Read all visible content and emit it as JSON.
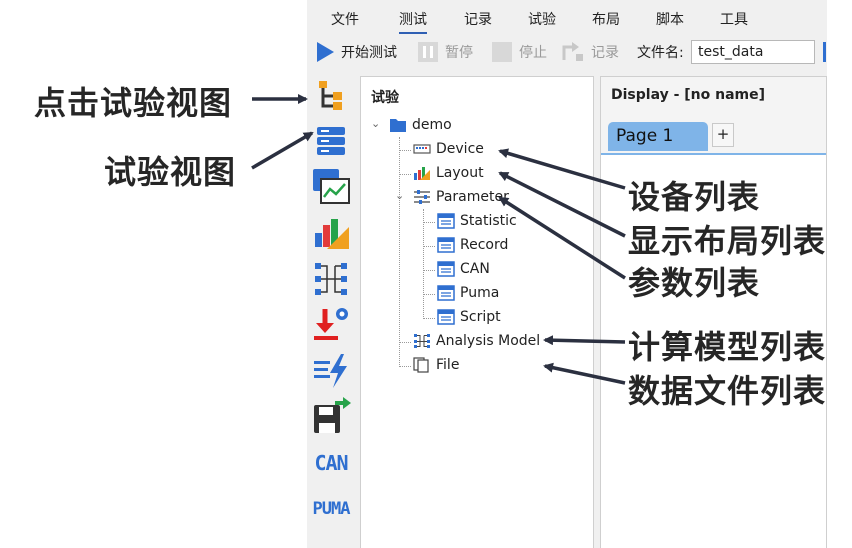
{
  "menu": {
    "items": [
      {
        "label": "文件"
      },
      {
        "label": "测试"
      },
      {
        "label": "记录"
      },
      {
        "label": "试验"
      },
      {
        "label": "布局"
      },
      {
        "label": "脚本"
      },
      {
        "label": "工具"
      }
    ],
    "active": "测试"
  },
  "toolbar": {
    "start_label": "开始测试",
    "pause_label": "暂停",
    "stop_label": "停止",
    "record_label": "记录",
    "filename_label": "文件名:",
    "filename_value": "test_data"
  },
  "sidebar": {
    "icons": [
      "experiment-view-icon",
      "database-icon",
      "chart-window-icon",
      "layout-chart-icon",
      "analysis-model-icon",
      "download-settings-icon",
      "script-run-icon",
      "save-export-icon",
      "can-icon",
      "puma-icon"
    ],
    "can_text": "CAN",
    "puma_text": "PUMA"
  },
  "tree_panel": {
    "title": "试验",
    "root": "demo",
    "device": "Device",
    "layout": "Layout",
    "parameter": "Parameter",
    "statistic": "Statistic",
    "record": "Record",
    "can": "CAN",
    "puma": "Puma",
    "script": "Script",
    "analysis_model": "Analysis Model",
    "file": "File"
  },
  "display_panel": {
    "title": "Display - [no name]",
    "tab_page": "Page 1",
    "tab_add": "+"
  },
  "annotations": {
    "click_view": "点击试验视图",
    "view": "试验视图",
    "device_list": "设备列表",
    "layout_list": "显示布局列表",
    "param_list": "参数列表",
    "model_list": "计算模型列表",
    "file_list": "数据文件列表"
  },
  "colors": {
    "accent": "#2f6fd0",
    "tab": "#7fb4e8",
    "orange": "#f0a020"
  }
}
